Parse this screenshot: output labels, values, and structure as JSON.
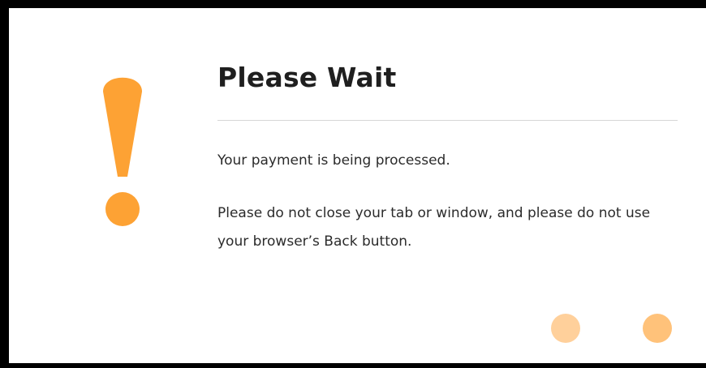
{
  "dialog": {
    "title": "Please Wait",
    "message_primary": "Your payment is being processed.",
    "message_secondary": "Please do not close your tab or window, and please do not use your browser’s Back button."
  },
  "icon": {
    "name": "exclamation-icon",
    "color": "#FDA234"
  },
  "loading_indicator": {
    "dot_colors": [
      "#FFD09B",
      "#FFC27A"
    ]
  }
}
